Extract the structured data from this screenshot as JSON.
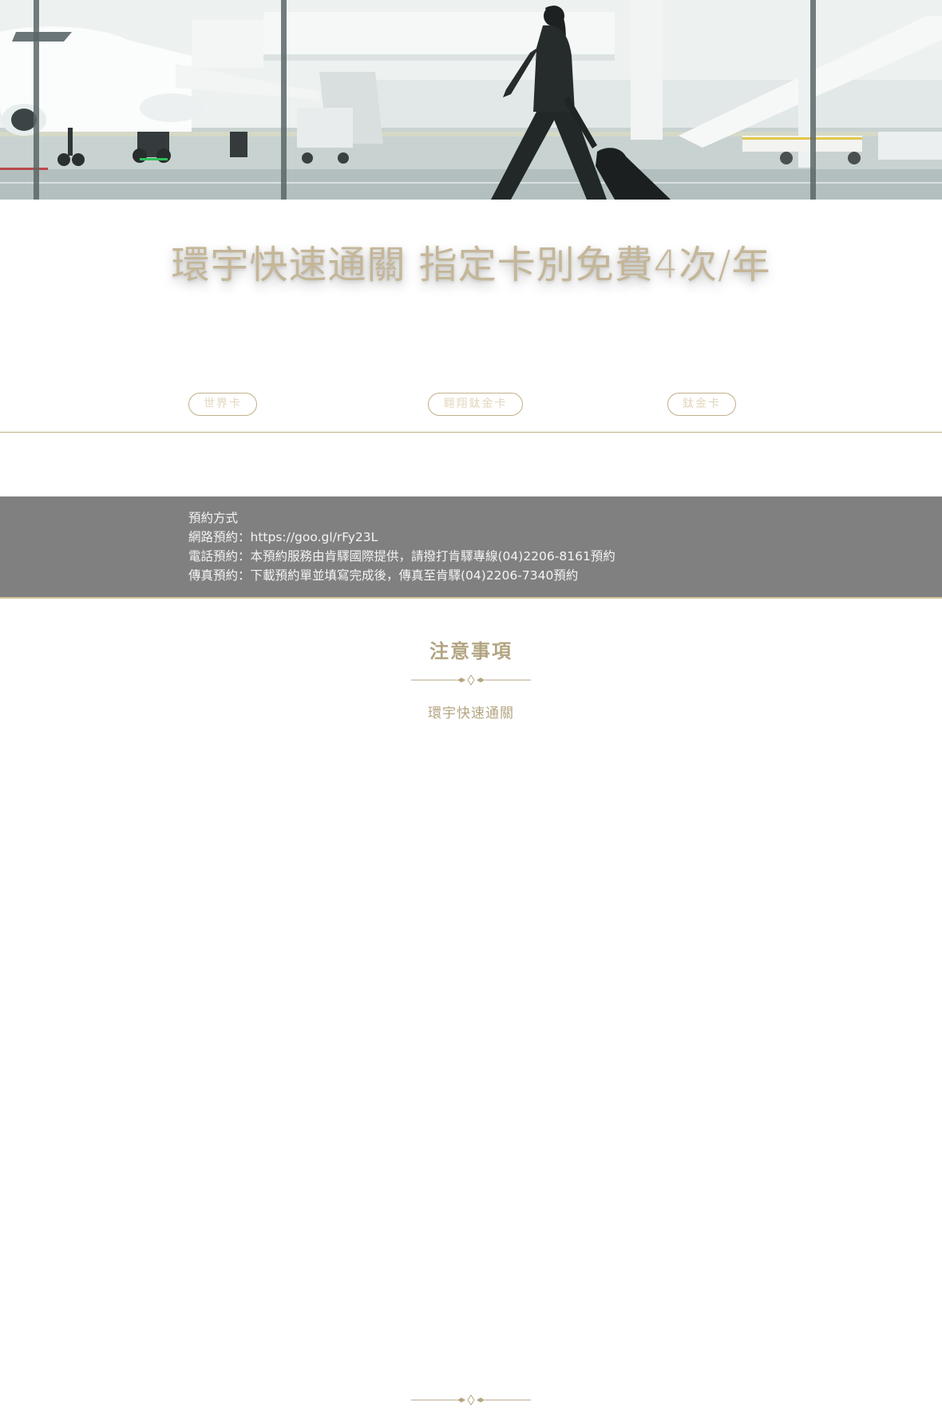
{
  "hero": {
    "image": "airport-traveler-photo"
  },
  "promo": {
    "title": "環宇快速通關 指定卡別免費4次/年"
  },
  "card_tabs": [
    {
      "label": "世界卡"
    },
    {
      "label": "翱翔鈦金卡"
    },
    {
      "label": "鈦金卡"
    }
  ],
  "reservation": {
    "heading": "預約方式",
    "online": "網路預約：https://goo.gl/rFy23L",
    "phone": "電話預約：本預約服務由肯驛國際提供，請撥打肯驛專線(04)2206-8161預約",
    "fax": "傳真預約：下載預約單並填寫完成後，傳真至肯驛(04)2206-7340預約"
  },
  "notes": {
    "heading": "注意事項",
    "subheading": "環宇快速通關"
  },
  "colors": {
    "gold": "#c4b08a",
    "gray_box": "#808080",
    "title_text": "#c4b698"
  }
}
